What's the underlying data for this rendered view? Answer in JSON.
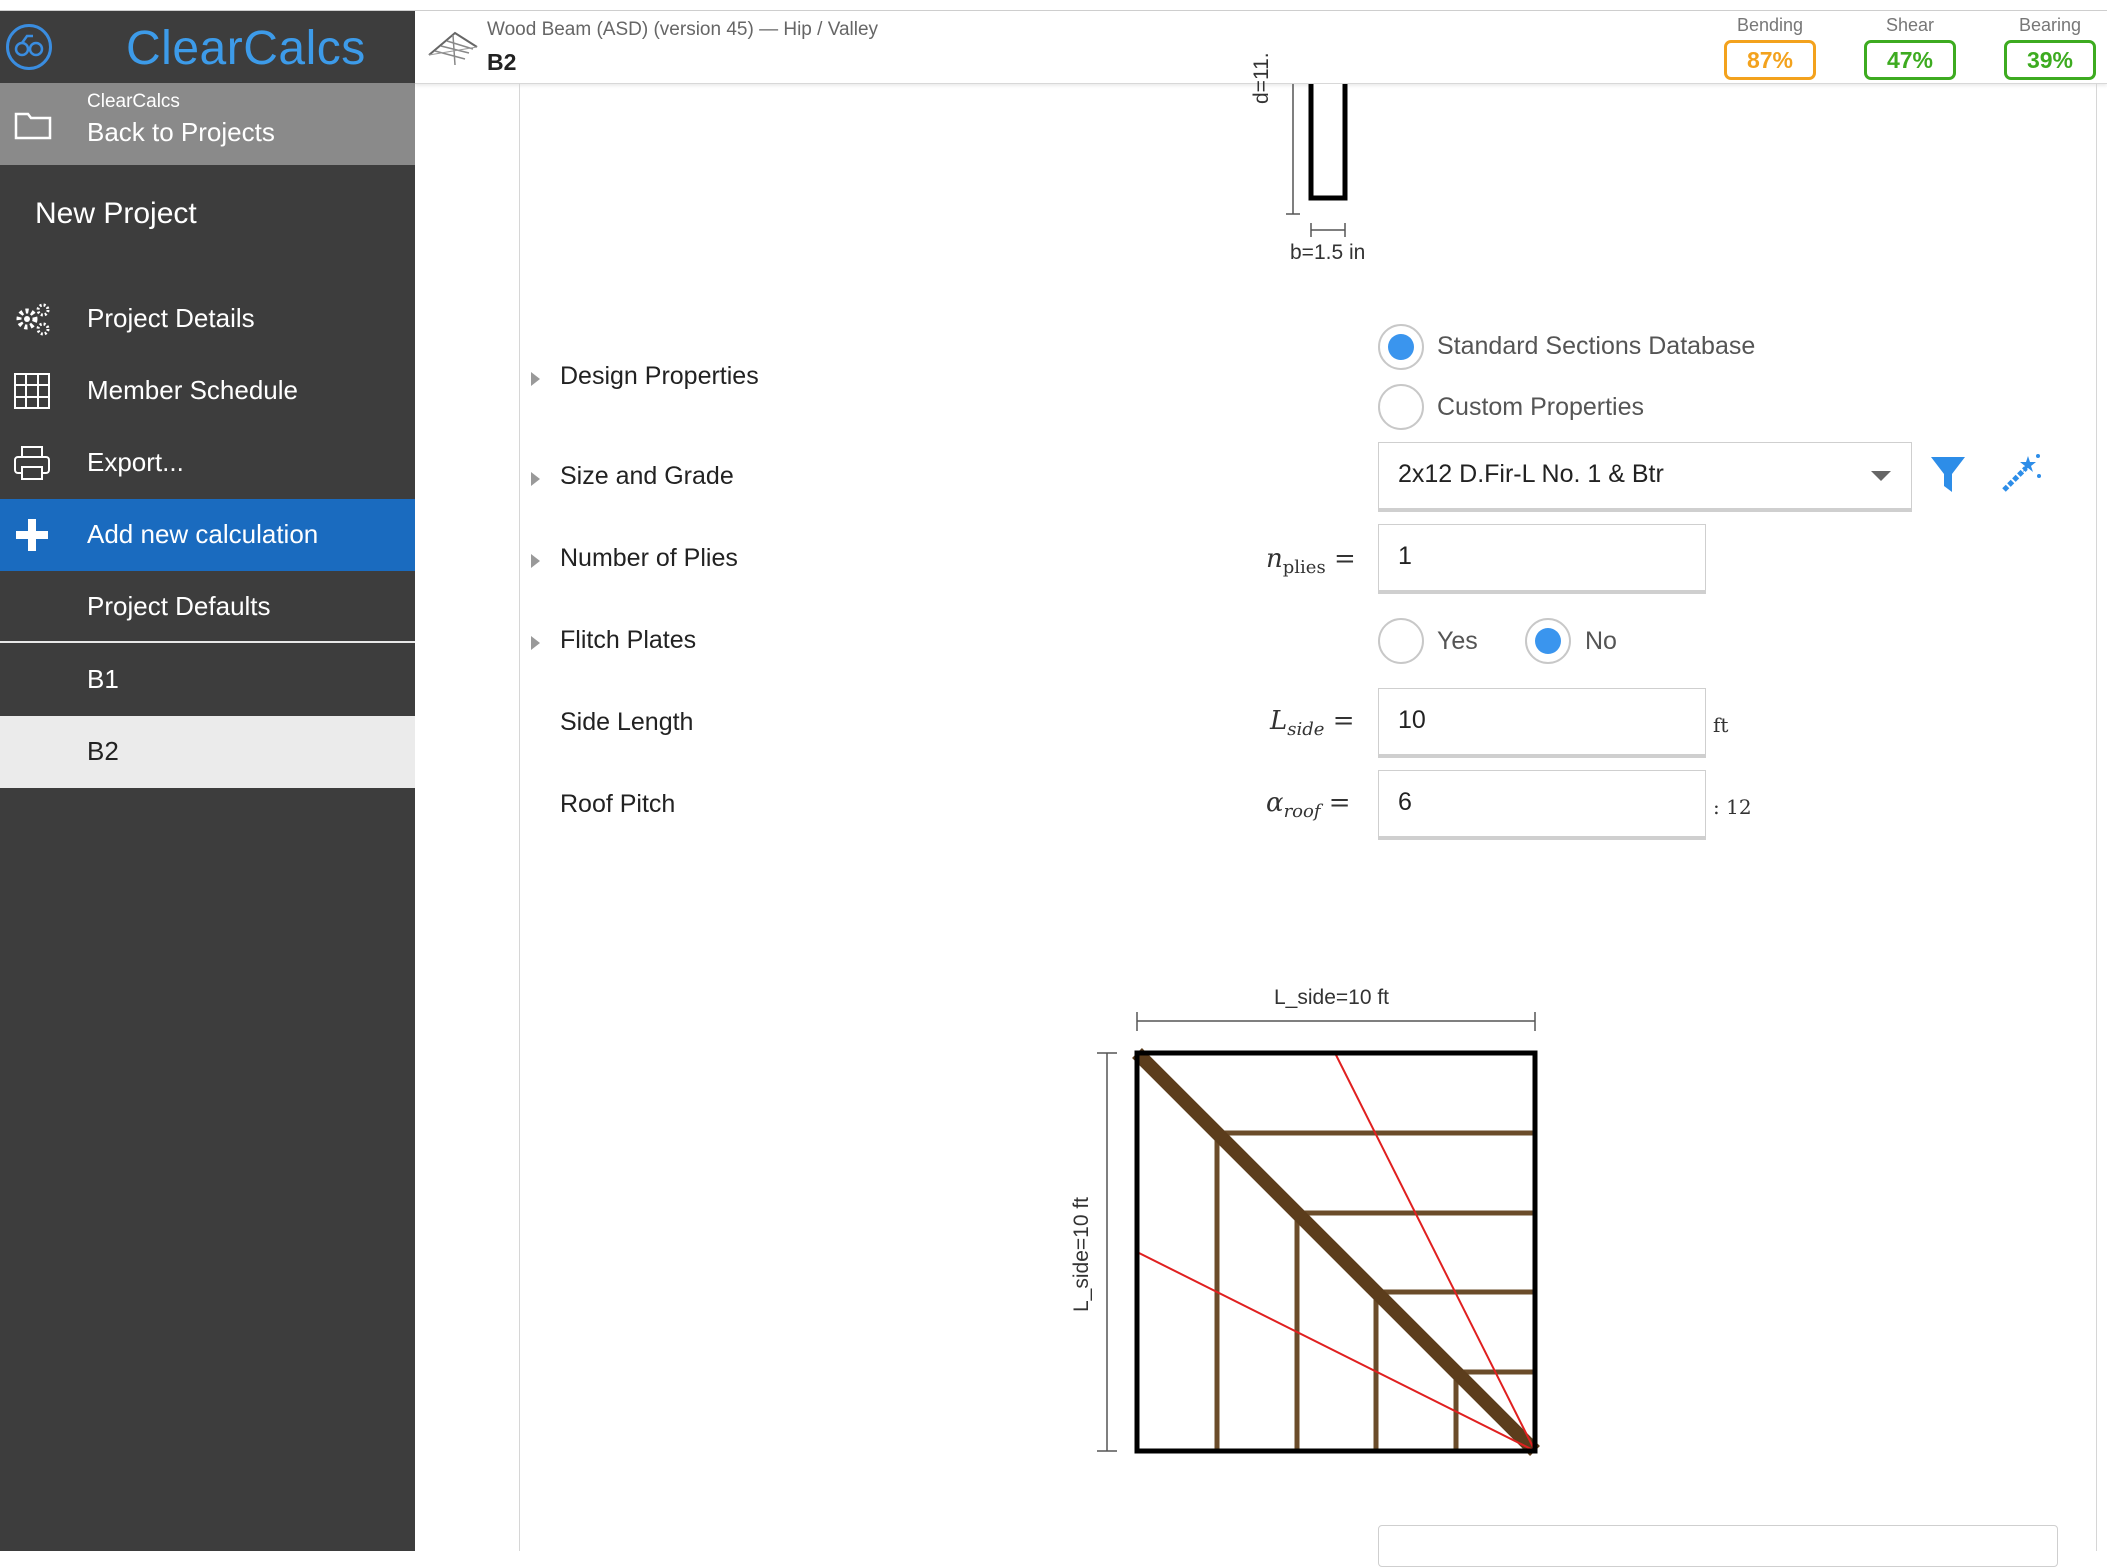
{
  "app": {
    "logo_text": "ClearCalcs",
    "back_small": "ClearCalcs",
    "back_label": "Back to Projects"
  },
  "sidebar": {
    "project_name": "New Project",
    "items": [
      {
        "label": "Project Details",
        "icon": "gears-icon"
      },
      {
        "label": "Member Schedule",
        "icon": "grid-icon"
      },
      {
        "label": "Export...",
        "icon": "printer-icon"
      },
      {
        "label": "Add new calculation",
        "icon": "plus-icon"
      },
      {
        "label": "Project Defaults",
        "icon": ""
      }
    ],
    "calcs": [
      "B1",
      "B2"
    ],
    "active_calc": "B2"
  },
  "header": {
    "subtitle": "Wood Beam (ASD) (version 45) — Hip / Valley",
    "title": "B2",
    "badges": [
      {
        "label": "Bending",
        "value": "87%",
        "color": "#f3a21d"
      },
      {
        "label": "Shear",
        "value": "47%",
        "color": "#3dab20"
      },
      {
        "label": "Bearing",
        "value": "39%",
        "color": "#3dab20"
      }
    ]
  },
  "section_drawing": {
    "depth_label": "d=11.",
    "width_label": "b=1.5 in"
  },
  "form": {
    "design_properties": {
      "label": "Design Properties",
      "options": [
        "Standard Sections Database",
        "Custom Properties"
      ],
      "selected": "Standard Sections Database"
    },
    "size_grade": {
      "label": "Size and Grade",
      "value": "2x12 D.Fir-L No. 1 & Btr"
    },
    "plies": {
      "label": "Number of Plies",
      "symbol": "n",
      "symbol_sub": "plies",
      "value": "1"
    },
    "flitch": {
      "label": "Flitch Plates",
      "options": [
        "Yes",
        "No"
      ],
      "selected": "No"
    },
    "side_length": {
      "label": "Side Length",
      "symbol": "L",
      "symbol_sub": "side",
      "value": "10",
      "unit": "ft"
    },
    "roof_pitch": {
      "label": "Roof Pitch",
      "symbol": "α",
      "symbol_sub": "roof",
      "value": "6",
      "unit": ": 12"
    }
  },
  "plan_drawing": {
    "top_dim": "L_side=10 ft",
    "left_dim": "L_side=10 ft"
  },
  "colors": {
    "sidebar_bg": "#3d3d3d",
    "active_nav": "#1a6bbf",
    "accent": "#3a95ee",
    "rafter": "#6b4c2a",
    "hip": "#5c3d1c",
    "section_lines": "#e02020"
  }
}
